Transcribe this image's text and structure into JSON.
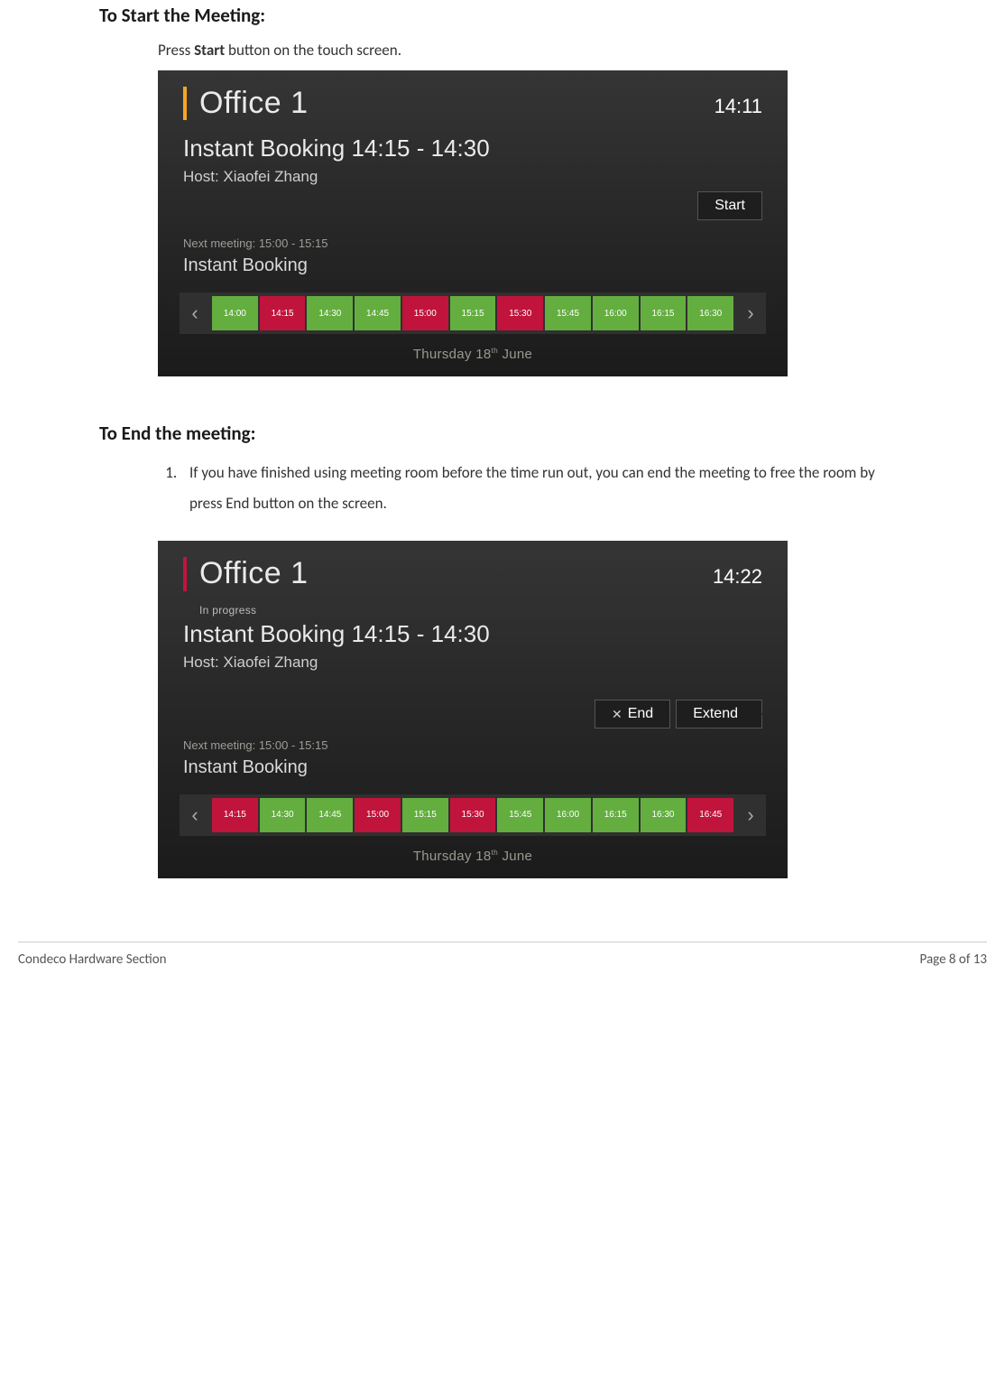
{
  "sections": {
    "start": {
      "heading": "To Start the Meeting:",
      "instruction_prefix": "Press ",
      "instruction_bold": "Start",
      "instruction_suffix": " button on the touch screen."
    },
    "end": {
      "heading": "To End the meeting:",
      "step1": "If you have finished using meeting room before the time run out, you can end the meeting to free the room by press End button on the screen."
    }
  },
  "screen1": {
    "room": "Office 1",
    "clock": "14:11",
    "meeting_name": "Instant Booking 14:15 - 14:30",
    "host": "Host: Xiaofei Zhang",
    "start_label": "Start",
    "next_meeting": "Next meeting: 15:00 - 15:15",
    "next_meeting_name": "Instant Booking",
    "timeline": [
      {
        "t": "14:00",
        "state": "free"
      },
      {
        "t": "14:15",
        "state": "busy"
      },
      {
        "t": "14:30",
        "state": "free"
      },
      {
        "t": "14:45",
        "state": "free"
      },
      {
        "t": "15:00",
        "state": "busy"
      },
      {
        "t": "15:15",
        "state": "free"
      },
      {
        "t": "15:30",
        "state": "busy"
      },
      {
        "t": "15:45",
        "state": "free"
      },
      {
        "t": "16:00",
        "state": "free"
      },
      {
        "t": "16:15",
        "state": "free"
      },
      {
        "t": "16:30",
        "state": "free"
      }
    ],
    "day": "Thursday 18",
    "day_suffix": "th",
    "day_month": " June"
  },
  "screen2": {
    "room": "Office 1",
    "clock": "14:22",
    "in_progress": "In progress",
    "meeting_name": "Instant Booking 14:15 - 14:30",
    "host": "Host: Xiaofei Zhang",
    "end_label": "End",
    "extend_label": "Extend",
    "next_meeting": "Next meeting: 15:00 - 15:15",
    "next_meeting_name": "Instant Booking",
    "timeline": [
      {
        "t": "14:15",
        "state": "busy"
      },
      {
        "t": "14:30",
        "state": "free"
      },
      {
        "t": "14:45",
        "state": "free"
      },
      {
        "t": "15:00",
        "state": "busy"
      },
      {
        "t": "15:15",
        "state": "free"
      },
      {
        "t": "15:30",
        "state": "busy"
      },
      {
        "t": "15:45",
        "state": "free"
      },
      {
        "t": "16:00",
        "state": "free"
      },
      {
        "t": "16:15",
        "state": "free"
      },
      {
        "t": "16:30",
        "state": "free"
      },
      {
        "t": "16:45",
        "state": "busy"
      }
    ],
    "day": "Thursday 18",
    "day_suffix": "th",
    "day_month": " June"
  },
  "footer": {
    "left": "Condeco Hardware Section",
    "right": "Page 8 of 13"
  }
}
